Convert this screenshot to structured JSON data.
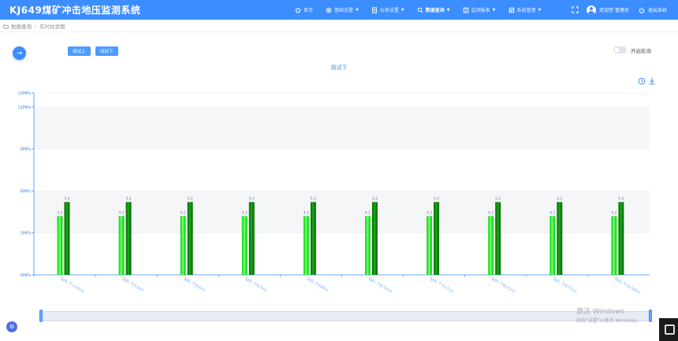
{
  "app": {
    "title": "KJ649煤矿冲击地压监测系统"
  },
  "nav": [
    {
      "label": "首页",
      "icon": "home-icon"
    },
    {
      "label": "基础设置",
      "icon": "settings-icon",
      "caret": "▼"
    },
    {
      "label": "仪表设置",
      "icon": "document-icon",
      "caret": "▼"
    },
    {
      "label": "数据查询",
      "icon": "search-icon",
      "caret": "▼",
      "active": true
    },
    {
      "label": "监测报表",
      "icon": "report-icon",
      "caret": "▼"
    },
    {
      "label": "系统管理",
      "icon": "system-icon",
      "caret": "▼"
    }
  ],
  "user": {
    "welcome": "欢迎您 管理员",
    "logout": "退出系统"
  },
  "breadcrumb": {
    "root": "数据查询",
    "separator": "/",
    "current": "实时柱状图"
  },
  "controls": {
    "round_button": "→",
    "btn_up": "测试上",
    "btn_down": "测试下",
    "carousel_label": "开启轮询",
    "corner_button": "⚙"
  },
  "colors": {
    "primary": "#3c8dff",
    "bar_light": "#1ee11e",
    "bar_dark": "#0a7a0a",
    "axis": "#3c8dff",
    "label": "#6b5fd8"
  },
  "chart_data": {
    "type": "bar",
    "title": "测试下",
    "categories": [
      "钻孔-下1(10m)",
      "钻孔-下2(3m)",
      "钻孔-下3(5m)",
      "钻孔-下4(7m)",
      "钻孔-下5(8m)",
      "钻孔-下6(10m)",
      "钻孔-下7(11m)",
      "钻孔-下8(15m)",
      "钻孔-下9(17m)",
      "钻孔-下10(18m)"
    ],
    "series": [
      {
        "values": [
          4.2,
          4.2,
          4.2,
          4.2,
          4.2,
          4.2,
          4.2,
          4.2,
          4.2,
          4.2
        ],
        "color": "#1ee11e"
      },
      {
        "values": [
          5.2,
          5.2,
          5.2,
          5.2,
          5.2,
          5.2,
          5.2,
          5.2,
          5.2,
          5.2
        ],
        "color": "#0a7a0a"
      }
    ],
    "yticks": [
      0,
      3,
      6,
      9,
      12,
      13
    ],
    "ytick_labels": [
      "0MPa",
      "3MPa",
      "6MPa",
      "9MPa",
      "12MPa",
      "13MPa"
    ],
    "ylim": [
      0,
      13
    ],
    "bands": [
      [
        3,
        6
      ],
      [
        9,
        12
      ]
    ]
  },
  "watermark": {
    "line1": "激活 Windows",
    "line2": "转到\"设置\"以激活 Windows。"
  }
}
